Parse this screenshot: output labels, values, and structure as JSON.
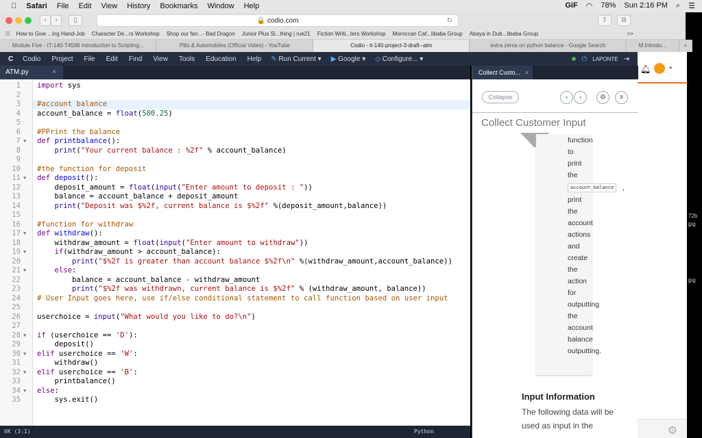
{
  "menubar": {
    "app": "Safari",
    "items": [
      "File",
      "Edit",
      "View",
      "History",
      "Bookmarks",
      "Window",
      "Help"
    ],
    "status": {
      "gif": "GiF",
      "battery": "78%",
      "clock": "Sun 2:16 PM"
    }
  },
  "browser": {
    "url": "codio.com",
    "bookmarks": [
      "How to Give ...ing Hand-Job",
      "Character De...rs Workshop",
      "Shop our fan...- Bad Dragon",
      "Junior Plus Si...thing | rue21",
      "Fiction Writi...ters Workshop",
      "Moroccan Caf...libaba Group",
      "Abaya in Dub...libaba Group"
    ],
    "bookmarks_more": ">>",
    "tabs": [
      {
        "label": "Module Five - IT-140-T4596 Introduction to Scripting...",
        "active": false
      },
      {
        "label": "Pills & Automobiles (Official Video) - YouTube",
        "active": false
      },
      {
        "label": "Codio - it-140-project-3-draft--atm",
        "active": true
      },
      {
        "label": "extra zeros on python balance - Google Search",
        "active": false
      }
    ],
    "extra_tab": "M Introdu..."
  },
  "codio": {
    "menu": [
      "Codio",
      "Project",
      "File",
      "Edit",
      "Find",
      "View",
      "Tools",
      "Education",
      "Help"
    ],
    "run": "Run Current",
    "google": "Google",
    "configure": "Configure...",
    "user": "LAPONTE"
  },
  "editor": {
    "file_tab": "ATM.py",
    "close": "×",
    "status_left": "6K (3:1)",
    "status_right": "Python",
    "highlight_line": 3,
    "fold_lines": [
      7,
      11,
      17,
      19,
      21,
      28,
      30,
      32,
      34
    ],
    "lines": [
      "import sys",
      "",
      "#account balance",
      "account_balance = float(500.25)",
      "",
      "#PPrint the balance",
      "def printbalance():",
      "    print(\"Your current balance : %2f\" % account_balance)",
      "",
      "#the function for deposit",
      "def deposit():",
      "    deposit_amount = float(input(\"Enter amount to deposit : \"))",
      "    balance = account_balance + deposit_amount",
      "    print(\"Deposit was $%2f, current balance is $%2f\" %(deposit_amount,balance))",
      "",
      "#function for withdraw",
      "def withdraw():",
      "    withdraw_amount = float(input(\"Enter amount to withdraw\"))",
      "    if(withdraw_amount > account_balance):",
      "        print(\"$%2f is greater than account balance $%2f\\n\" %(withdraw_amount,account_balance))",
      "    else:",
      "        balance = account_balance - withdraw_amount",
      "        print(\"$%2f was withdrawn, current balance is $%2f\" % (withdraw_amount, balance))",
      "# User Input goes here, use if/else conditional statement to call function based on user input",
      "",
      "userchoice = input(\"What would you like to do?\\n\")",
      "",
      "if (userchoice == 'D'):",
      "    deposit()",
      "elif userchoice == 'W':",
      "    withdraw()",
      "elif userchoice == 'B':",
      "    printbalance()",
      "else:",
      "    sys.exit()"
    ]
  },
  "guide": {
    "tab": "Collect Custo...",
    "close": "×",
    "collapse": "Collapse",
    "title": "Collect Customer Input",
    "words": [
      "function",
      "to",
      "print",
      "the",
      "account_balance",
      ",",
      "print",
      "the",
      "account",
      "actions",
      "and",
      "create",
      "the",
      "action",
      "for",
      "outputting",
      "the",
      "account",
      "balance",
      "outputting."
    ],
    "section_title": "Input Information",
    "section_text": "The following data will be used as input in the"
  },
  "behind": {
    "snippets": [
      "72b",
      "jpg",
      "jpg"
    ]
  }
}
